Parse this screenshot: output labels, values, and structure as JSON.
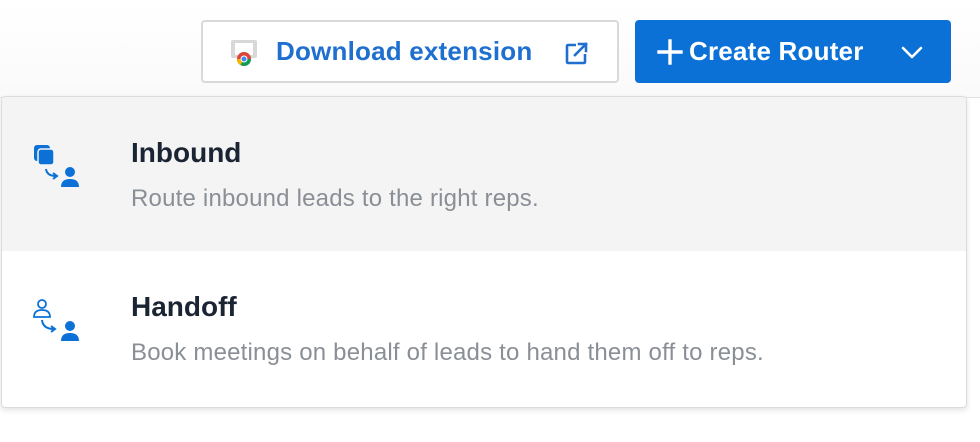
{
  "header": {
    "download_button": {
      "label": "Download extension",
      "icon": "chrome-icon",
      "trailing_icon": "external-link-icon"
    },
    "create_button": {
      "label": "Create Router",
      "leading_icon": "plus-icon",
      "trailing_icon": "chevron-down-icon"
    }
  },
  "dropdown": {
    "items": [
      {
        "title": "Inbound",
        "description": "Route inbound leads to the right reps.",
        "icon": "inbound-router-icon"
      },
      {
        "title": "Handoff",
        "description": "Book meetings on behalf of leads to hand them off to reps.",
        "icon": "handoff-router-icon"
      }
    ]
  },
  "colors": {
    "primary": "#0b71d6",
    "link": "#1f6fd0",
    "title": "#1a2433",
    "muted": "#8a8f96",
    "hover_bg": "#f4f4f4"
  }
}
